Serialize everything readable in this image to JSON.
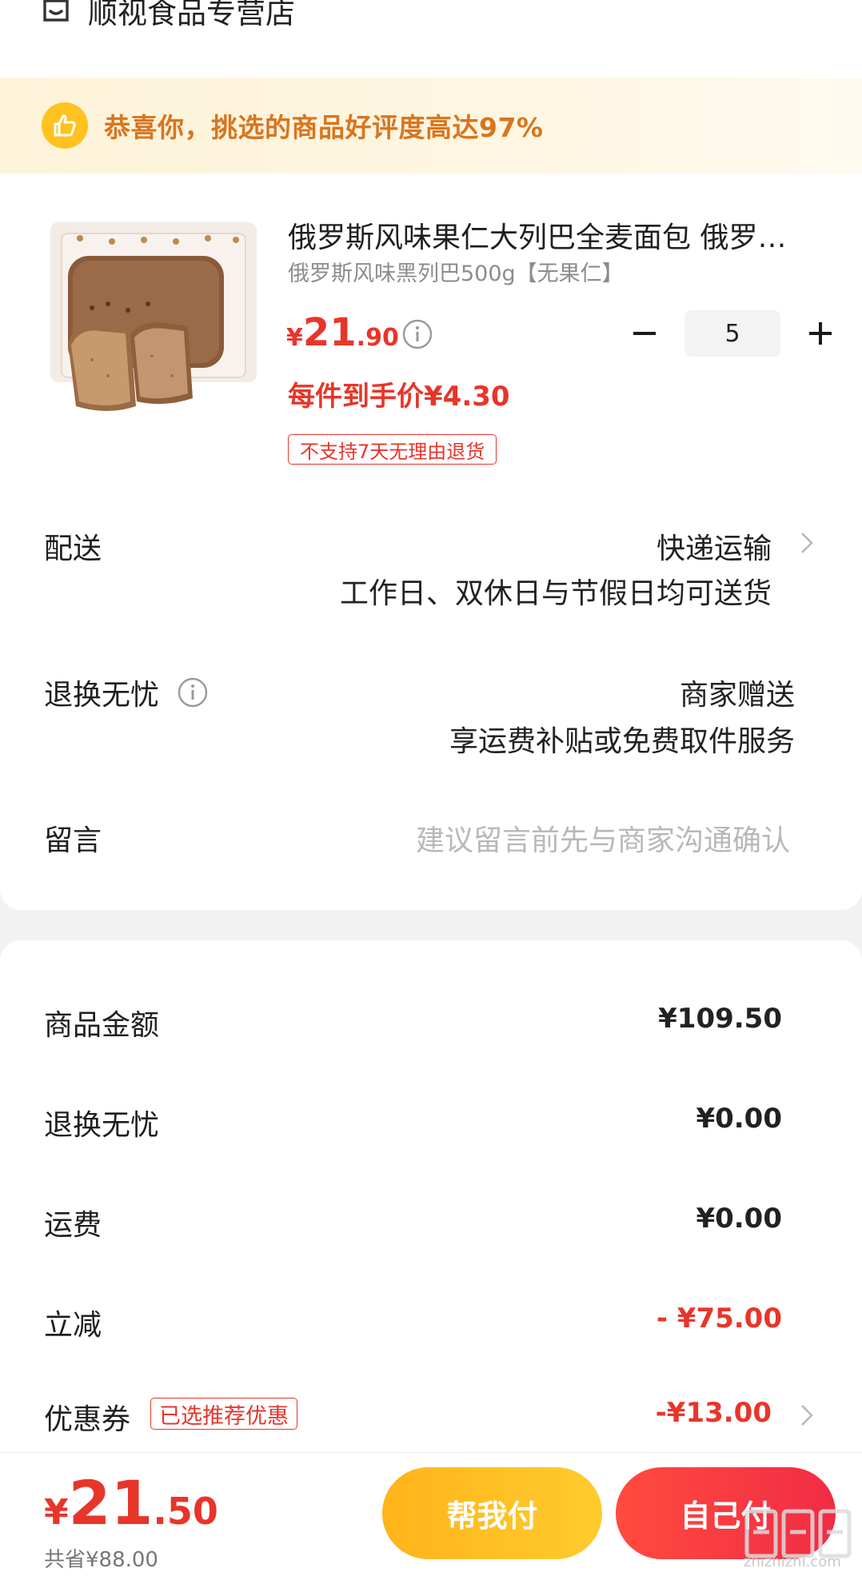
{
  "store": {
    "name": "顺视食品专营店",
    "icon": "store-icon"
  },
  "banner": {
    "text": "恭喜你，挑选的商品好评度高达97%",
    "icon": "thumbs-up-icon",
    "accent": "#d9751e"
  },
  "product": {
    "title": "俄罗斯风味果仁大列巴全麦面包 俄罗斯风味果仁大列巴全麦面包",
    "sku": "俄罗斯风味黑列巴500g【无果仁】",
    "price_currency": "¥",
    "price_int": "21",
    "price_dec": ".90",
    "final_price": "每件到手价¥4.30",
    "tag": "不支持7天无理由退货",
    "quantity": "5",
    "minus_label": "−",
    "plus_label": "+"
  },
  "delivery": {
    "label": "配送",
    "method": "快递运输",
    "note": "工作日、双休日与节假日均可送货"
  },
  "returns": {
    "label": "退换无忧",
    "value": "商家赠送",
    "note": "享运费补贴或免费取件服务"
  },
  "message": {
    "label": "留言",
    "placeholder": "建议留言前先与商家沟通确认"
  },
  "summary": {
    "goods_label": "商品金额",
    "goods_value": "¥109.50",
    "returns_label": "退换无忧",
    "returns_value": "¥0.00",
    "shipping_label": "运费",
    "shipping_value": "¥0.00",
    "discount_label": "立减",
    "discount_value": "- ¥75.00",
    "coupon_label": "优惠券",
    "coupon_badge": "已选推荐优惠",
    "coupon_value": "-¥13.00"
  },
  "footer": {
    "total_currency": "¥",
    "total_int": "21",
    "total_dec": ".50",
    "saved": "共省¥88.00",
    "help_pay": "帮我付",
    "self_pay": "自己付"
  },
  "watermark": {
    "text": "zhizhizhi.com"
  },
  "colors": {
    "red": "#e8352a",
    "yellow": "#ffc21f"
  }
}
